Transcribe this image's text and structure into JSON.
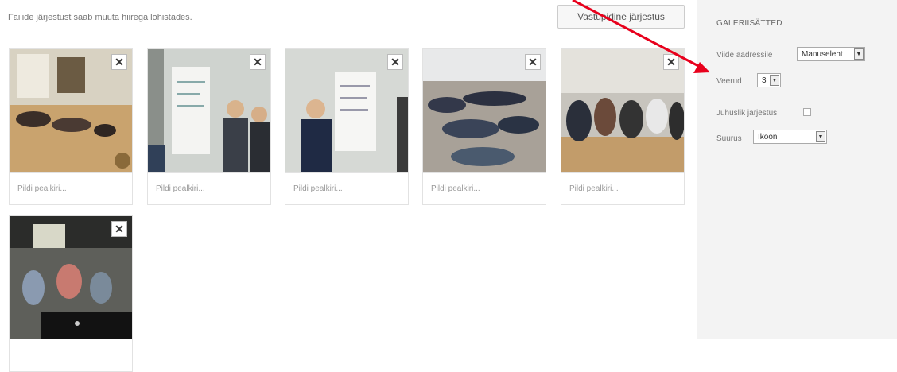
{
  "gallery": {
    "hint": "Failide järjestust saab muuta hiirega lohistades.",
    "reverse_label": "Vastupidine järjestus",
    "caption_placeholder": "Pildi pealkiri...",
    "close_glyph": "✕",
    "items": [
      {
        "id": "photo-1"
      },
      {
        "id": "photo-2"
      },
      {
        "id": "photo-3"
      },
      {
        "id": "photo-4"
      },
      {
        "id": "photo-5"
      },
      {
        "id": "photo-6"
      }
    ]
  },
  "settings": {
    "title": "GALERIISÄTTED",
    "link_label": "Viide aadressile",
    "link_value": "Manuseleht",
    "columns_label": "Veerud",
    "columns_value": "3",
    "random_label": "Juhuslik järjestus",
    "size_label": "Suurus",
    "size_value": "Ikoon",
    "dropdown_glyph": "▼"
  },
  "colors": {
    "annotation_arrow": "#e8001c",
    "sidebar_bg": "#f3f3f3"
  }
}
